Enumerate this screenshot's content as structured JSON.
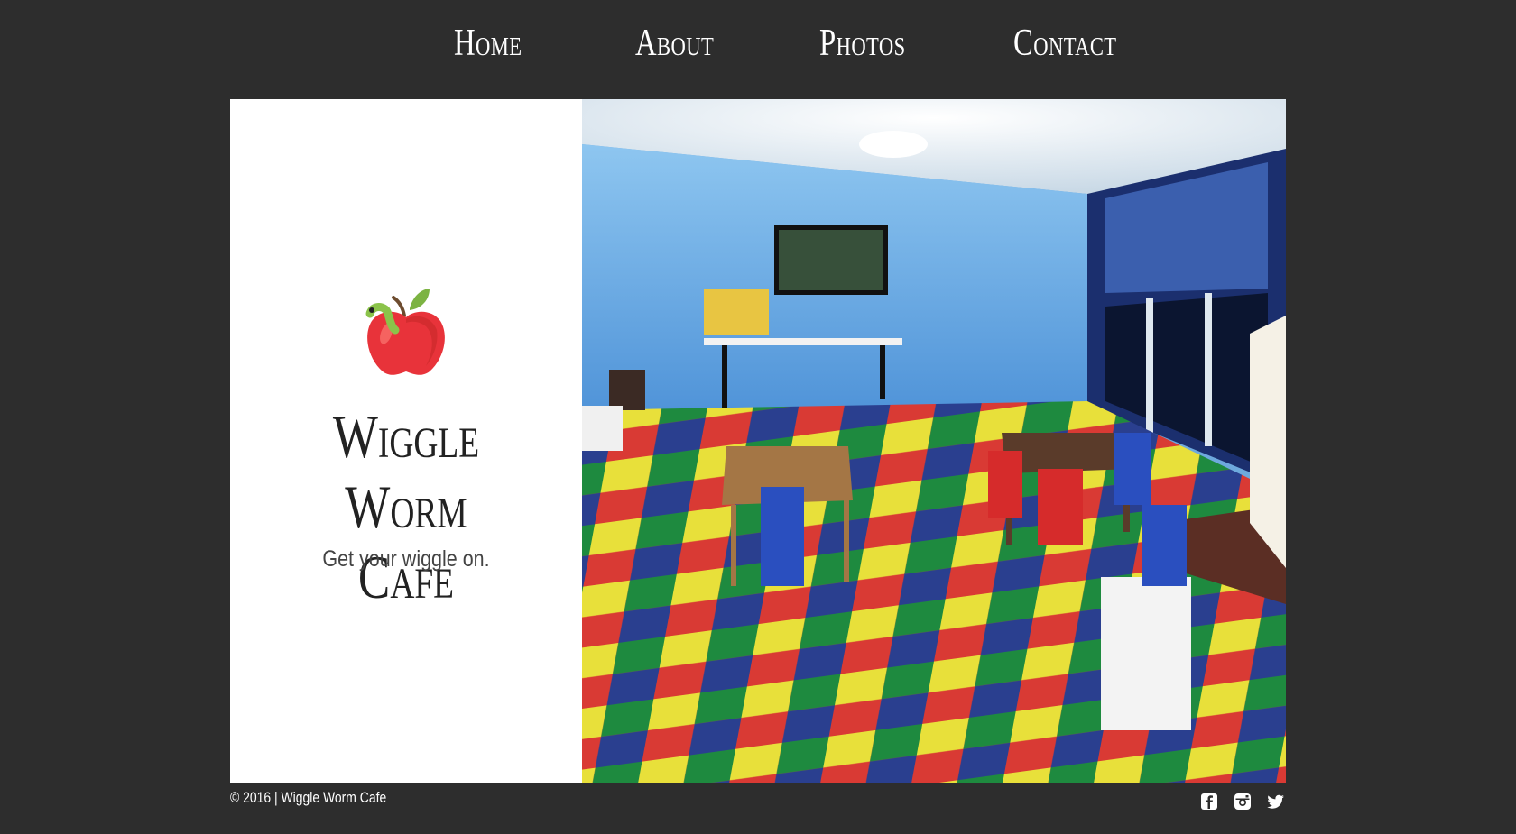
{
  "nav": {
    "items": [
      {
        "label": "Home"
      },
      {
        "label": "About"
      },
      {
        "label": "Photos"
      },
      {
        "label": "Contact"
      }
    ]
  },
  "hero": {
    "title_line1": "Wiggle Worm",
    "title_line2": "Cafe",
    "tagline": "Get your wiggle on.",
    "logo_icon": "apple-with-worm-icon",
    "photo_alt": "Playroom with colorful floor mats, small tables and chairs"
  },
  "footer": {
    "copyright": "© 2016 | Wiggle Worm Cafe",
    "social": [
      {
        "icon": "facebook-icon"
      },
      {
        "icon": "instagram-icon"
      },
      {
        "icon": "twitter-icon"
      }
    ]
  },
  "colors": {
    "background": "#2d2d2d",
    "panel": "#ffffff",
    "apple": "#e8333a",
    "leaf": "#6aa84f"
  }
}
